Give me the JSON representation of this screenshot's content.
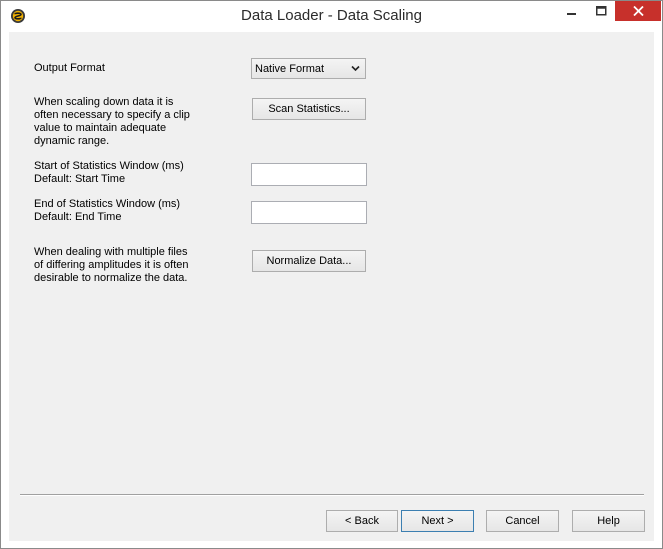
{
  "window": {
    "title": "Data Loader - Data Scaling",
    "app_icon": "app-logo-icon"
  },
  "titlebar_buttons": {
    "minimize_icon": "minimize-icon",
    "maximize_icon": "maximize-icon",
    "close_icon": "close-icon",
    "close_color": "#c7302b"
  },
  "form": {
    "output_format_label": "Output Format",
    "output_format_value": "Native Format",
    "scaling_description": "When scaling down data it is\noften necessary to specify a clip\nvalue to maintain adequate\ndynamic range.",
    "scan_statistics_button": "Scan Statistics...",
    "start_window_label": "Start of Statistics Window (ms)\nDefault: Start Time",
    "start_window_value": "",
    "end_window_label": "End of Statistics Window (ms)\nDefault: End Time",
    "end_window_value": "",
    "normalize_description": "When dealing with multiple files\nof differing amplitudes it is often\ndesirable to normalize the data.",
    "normalize_button": "Normalize Data..."
  },
  "footer": {
    "back_button": "< Back",
    "next_button": "Next >",
    "cancel_button": "Cancel",
    "help_button": "Help"
  }
}
